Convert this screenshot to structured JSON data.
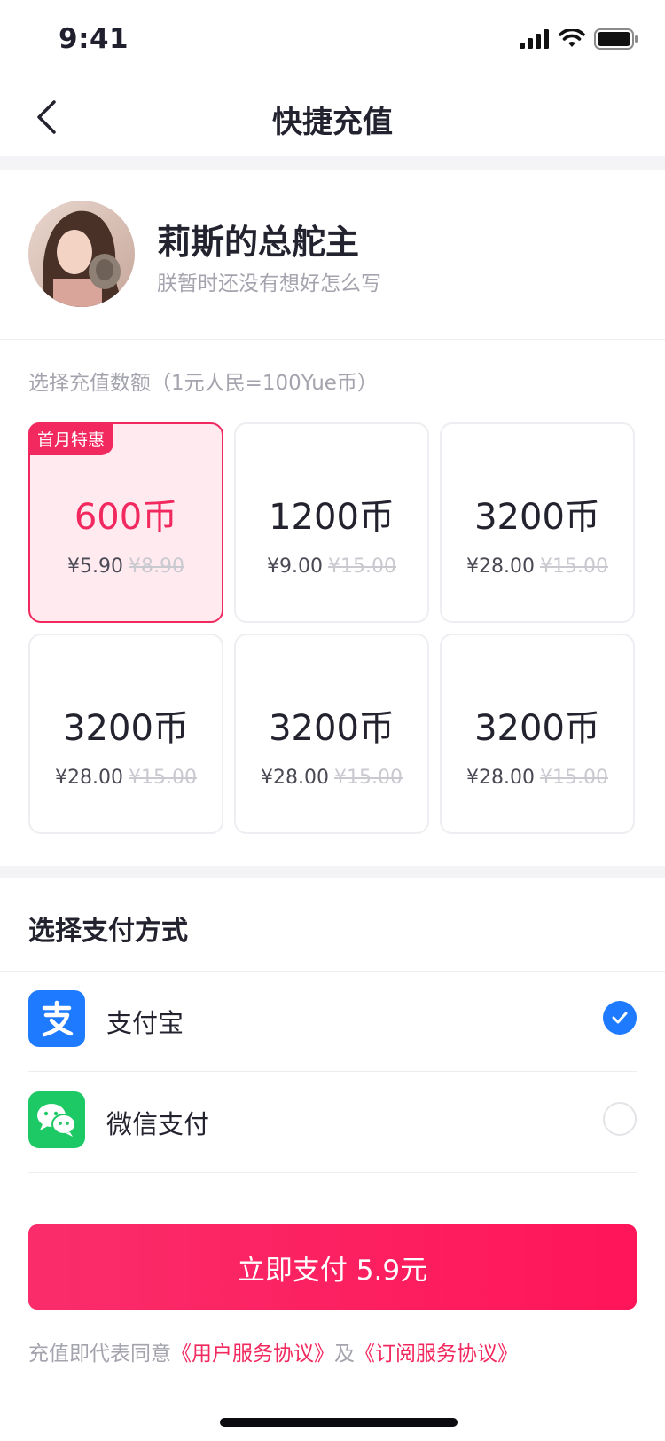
{
  "status_bar": {
    "time": "9:41"
  },
  "nav": {
    "title": "快捷充值"
  },
  "profile": {
    "name": "莉斯的总舵主",
    "motto": "朕暂时还没有想好怎么写"
  },
  "amount_hint": "选择充值数额（1元人民=100Yue币）",
  "packages": [
    {
      "coins": "600币",
      "price": "¥5.90",
      "original": "¥8.90",
      "badge": "首月特惠",
      "selected": true
    },
    {
      "coins": "1200币",
      "price": "¥9.00",
      "original": "¥15.00",
      "badge": "",
      "selected": false
    },
    {
      "coins": "3200币",
      "price": "¥28.00",
      "original": "¥15.00",
      "badge": "",
      "selected": false
    },
    {
      "coins": "3200币",
      "price": "¥28.00",
      "original": "¥15.00",
      "badge": "",
      "selected": false
    },
    {
      "coins": "3200币",
      "price": "¥28.00",
      "original": "¥15.00",
      "badge": "",
      "selected": false
    },
    {
      "coins": "3200币",
      "price": "¥28.00",
      "original": "¥15.00",
      "badge": "",
      "selected": false
    }
  ],
  "payment": {
    "title": "选择支付方式",
    "options": [
      {
        "label": "支付宝",
        "icon": "alipay-icon",
        "color": "#1e7bff",
        "checked": true
      },
      {
        "label": "微信支付",
        "icon": "wechat-icon",
        "color": "#1cc964",
        "checked": false
      }
    ]
  },
  "pay_button": {
    "label": "立即支付 5.9元"
  },
  "agreement": {
    "prefix": "充值即代表同意",
    "link1": "《用户服务协议》",
    "middle": "及",
    "link2": "《订阅服务协议》"
  },
  "colors": {
    "accent": "#f2295f",
    "alipay": "#1e7bff",
    "wechat": "#1cc964"
  }
}
